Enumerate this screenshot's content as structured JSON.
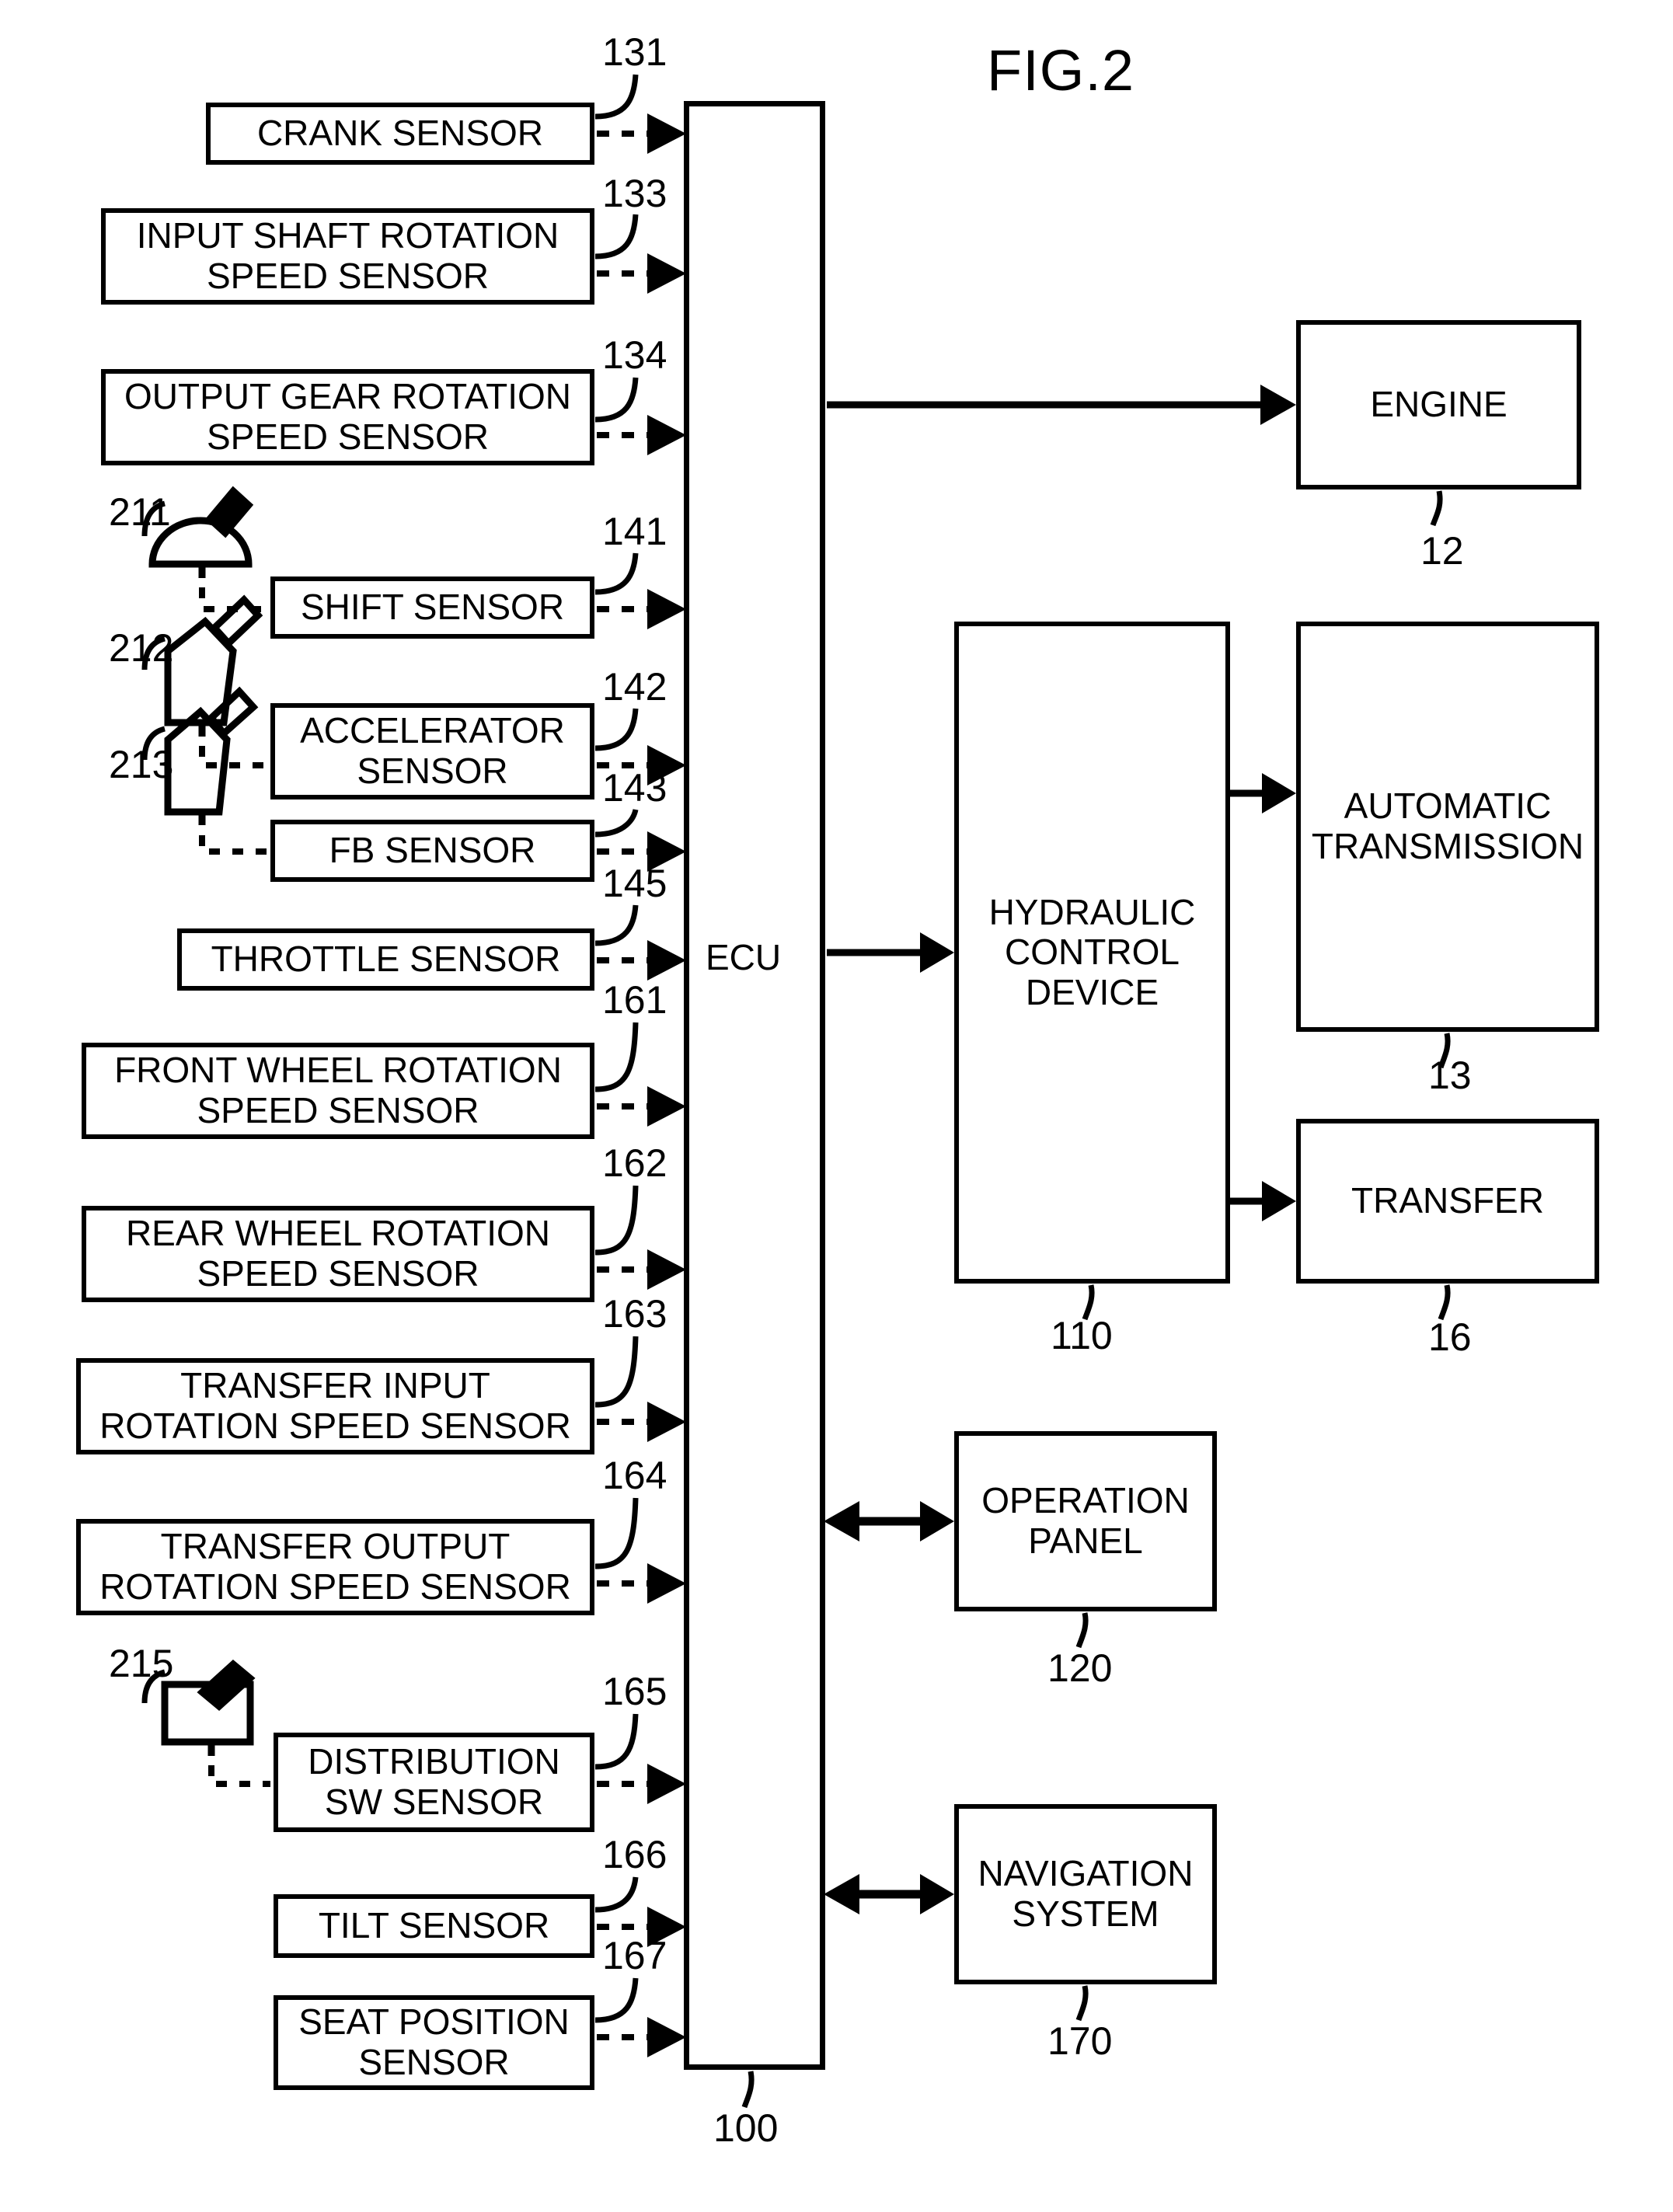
{
  "figure": {
    "title": "FIG.2",
    "ecu_label": "ECU",
    "ecu_ref": "100"
  },
  "sensors": [
    {
      "label": "CRANK SENSOR",
      "ref": "131",
      "icon": null
    },
    {
      "label": "INPUT SHAFT ROTATION SPEED SENSOR",
      "ref": "133",
      "icon": null
    },
    {
      "label": "OUTPUT GEAR ROTATION SPEED SENSOR",
      "ref": "134",
      "icon": null
    },
    {
      "label": "SHIFT SENSOR",
      "ref": "141",
      "icon": "shift-knob-icon",
      "icon_ref": "211"
    },
    {
      "label": "ACCELERATOR SENSOR",
      "ref": "142",
      "icon": "accelerator-pedal-icon",
      "icon_ref": "212"
    },
    {
      "label": "FB SENSOR",
      "ref": "143",
      "icon": "brake-pedal-icon",
      "icon_ref": "213"
    },
    {
      "label": "THROTTLE SENSOR",
      "ref": "145",
      "icon": null
    },
    {
      "label": "FRONT WHEEL ROTATION SPEED SENSOR",
      "ref": "161",
      "icon": null
    },
    {
      "label": "REAR WHEEL ROTATION SPEED SENSOR",
      "ref": "162",
      "icon": null
    },
    {
      "label": "TRANSFER INPUT ROTATION SPEED SENSOR",
      "ref": "163",
      "icon": null
    },
    {
      "label": "TRANSFER OUTPUT ROTATION SPEED SENSOR",
      "ref": "164",
      "icon": null
    },
    {
      "label": "DISTRIBUTION SW SENSOR",
      "ref": "165",
      "icon": "toggle-switch-icon",
      "icon_ref": "215"
    },
    {
      "label": "TILT SENSOR",
      "ref": "166",
      "icon": null
    },
    {
      "label": "SEAT POSITION SENSOR",
      "ref": "167",
      "icon": null
    }
  ],
  "sensor_lines": {
    "s0_l1": "CRANK SENSOR",
    "s1_l1": "INPUT SHAFT ROTATION",
    "s1_l2": "SPEED SENSOR",
    "s2_l1": "OUTPUT GEAR ROTATION",
    "s2_l2": "SPEED SENSOR",
    "s3_l1": "SHIFT SENSOR",
    "s4_l1": "ACCELERATOR",
    "s4_l2": "SENSOR",
    "s5_l1": "FB SENSOR",
    "s6_l1": "THROTTLE SENSOR",
    "s7_l1": "FRONT WHEEL ROTATION",
    "s7_l2": "SPEED SENSOR",
    "s8_l1": "REAR WHEEL ROTATION",
    "s8_l2": "SPEED SENSOR",
    "s9_l1": "TRANSFER INPUT",
    "s9_l2": "ROTATION SPEED SENSOR",
    "s10_l1": "TRANSFER OUTPUT",
    "s10_l2": "ROTATION SPEED SENSOR",
    "s11_l1": "DISTRIBUTION",
    "s11_l2": "SW SENSOR",
    "s12_l1": "TILT SENSOR",
    "s13_l1": "SEAT POSITION",
    "s13_l2": "SENSOR"
  },
  "icon_refs": {
    "shift": "211",
    "accelerator": "212",
    "fb": "213",
    "distribution": "215"
  },
  "sensor_refs": {
    "crank": "131",
    "input_shaft": "133",
    "output_gear": "134",
    "shift": "141",
    "accelerator": "142",
    "fb": "143",
    "throttle": "145",
    "front_wheel": "161",
    "rear_wheel": "162",
    "transfer_input": "163",
    "transfer_output": "164",
    "distribution_sw": "165",
    "tilt": "166",
    "seat_position": "167"
  },
  "outputs": [
    {
      "label": "ENGINE",
      "ref": "12"
    },
    {
      "label": "HYDRAULIC CONTROL DEVICE",
      "ref": "110"
    },
    {
      "label": "AUTOMATIC TRANSMISSION",
      "ref": "13"
    },
    {
      "label": "TRANSFER",
      "ref": "16"
    },
    {
      "label": "OPERATION PANEL",
      "ref": "120"
    },
    {
      "label": "NAVIGATION SYSTEM",
      "ref": "170"
    }
  ],
  "output_lines": {
    "engine_l1": "ENGINE",
    "hydraulic_l1": "HYDRAULIC",
    "hydraulic_l2": "CONTROL",
    "hydraulic_l3": "DEVICE",
    "at_l1": "AUTOMATIC",
    "at_l2": "TRANSMISSION",
    "transfer_l1": "TRANSFER",
    "oppanel_l1": "OPERATION",
    "oppanel_l2": "PANEL",
    "nav_l1": "NAVIGATION",
    "nav_l2": "SYSTEM"
  },
  "output_refs": {
    "engine": "12",
    "hydraulic": "110",
    "automatic_transmission": "13",
    "transfer": "16",
    "operation_panel": "120",
    "navigation_system": "170"
  },
  "colors": {
    "stroke": "#000000",
    "background": "#ffffff"
  }
}
